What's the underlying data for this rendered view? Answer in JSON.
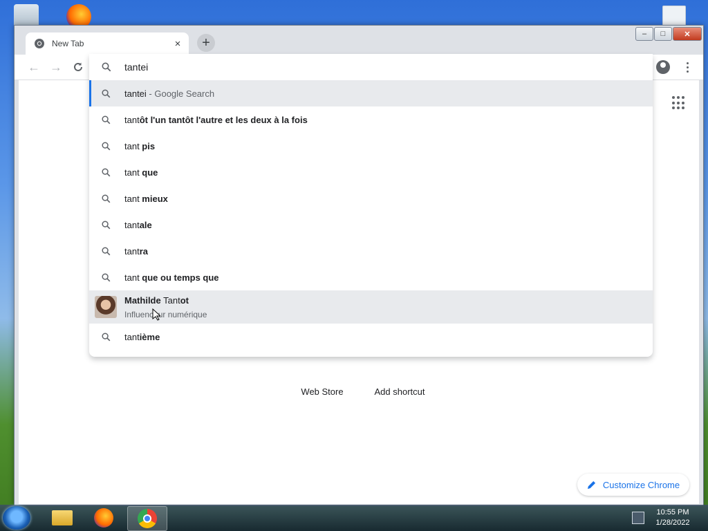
{
  "tab": {
    "title": "New Tab",
    "close": "×"
  },
  "newtab_symbol": "+",
  "window_controls": {
    "minimize": "–",
    "maximize": "□",
    "close": "✕"
  },
  "omnibox": {
    "query": "tantei",
    "selected": {
      "typed": "tantei",
      "suffix": " - Google Search"
    },
    "suggestions": [
      {
        "typed": "tant",
        "completion": "ôt l'un tantôt l'autre et les deux à la fois"
      },
      {
        "typed": "tant ",
        "completion": "pis"
      },
      {
        "typed": "tant ",
        "completion": "que"
      },
      {
        "typed": "tant ",
        "completion": "mieux"
      },
      {
        "typed": "tant",
        "completion": "ale"
      },
      {
        "typed": "tant",
        "completion": "ra"
      },
      {
        "typed": "tant ",
        "completion": "que ou temps que"
      }
    ],
    "entity": {
      "name_bold": "Mathilde",
      "name_plain": " Tant",
      "name_bold2": "ot",
      "description": "Influenceur numérique"
    },
    "last": {
      "typed": "tant",
      "completion": "ième"
    }
  },
  "shortcuts": {
    "web_store": "Web Store",
    "add_shortcut": "Add shortcut"
  },
  "customize_label": "Customize Chrome",
  "taskbar": {
    "time": "10:55 PM",
    "date": "1/28/2022"
  },
  "colors": {
    "accent": "#1a73e8",
    "selected_bg": "#e8eaed"
  }
}
